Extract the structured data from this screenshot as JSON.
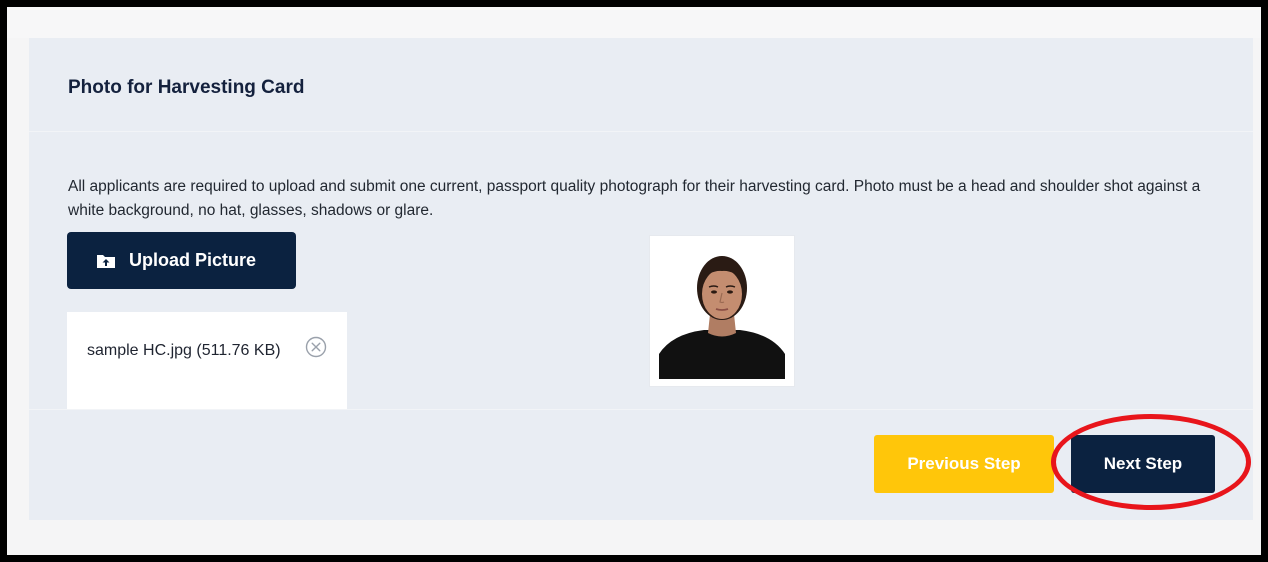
{
  "section": {
    "title": "Photo for Harvesting Card",
    "description": "All applicants are required to upload and submit one current, passport quality photograph for their harvesting card. Photo must be a head and shoulder shot against a white background, no hat, glasses, shadows or glare."
  },
  "upload": {
    "button_label": "Upload Picture",
    "icon": "upload-folder-icon"
  },
  "file": {
    "name": "sample HC.jpg (511.76 KB)",
    "remove_icon": "close-circle-icon"
  },
  "photo": {
    "alt": "Uploaded passport photo"
  },
  "navigation": {
    "previous_label": "Previous Step",
    "next_label": "Next Step"
  },
  "colors": {
    "navy": "#0b2240",
    "yellow": "#ffc60a",
    "highlight": "#e8151b",
    "card_bg": "#e9edf3"
  }
}
